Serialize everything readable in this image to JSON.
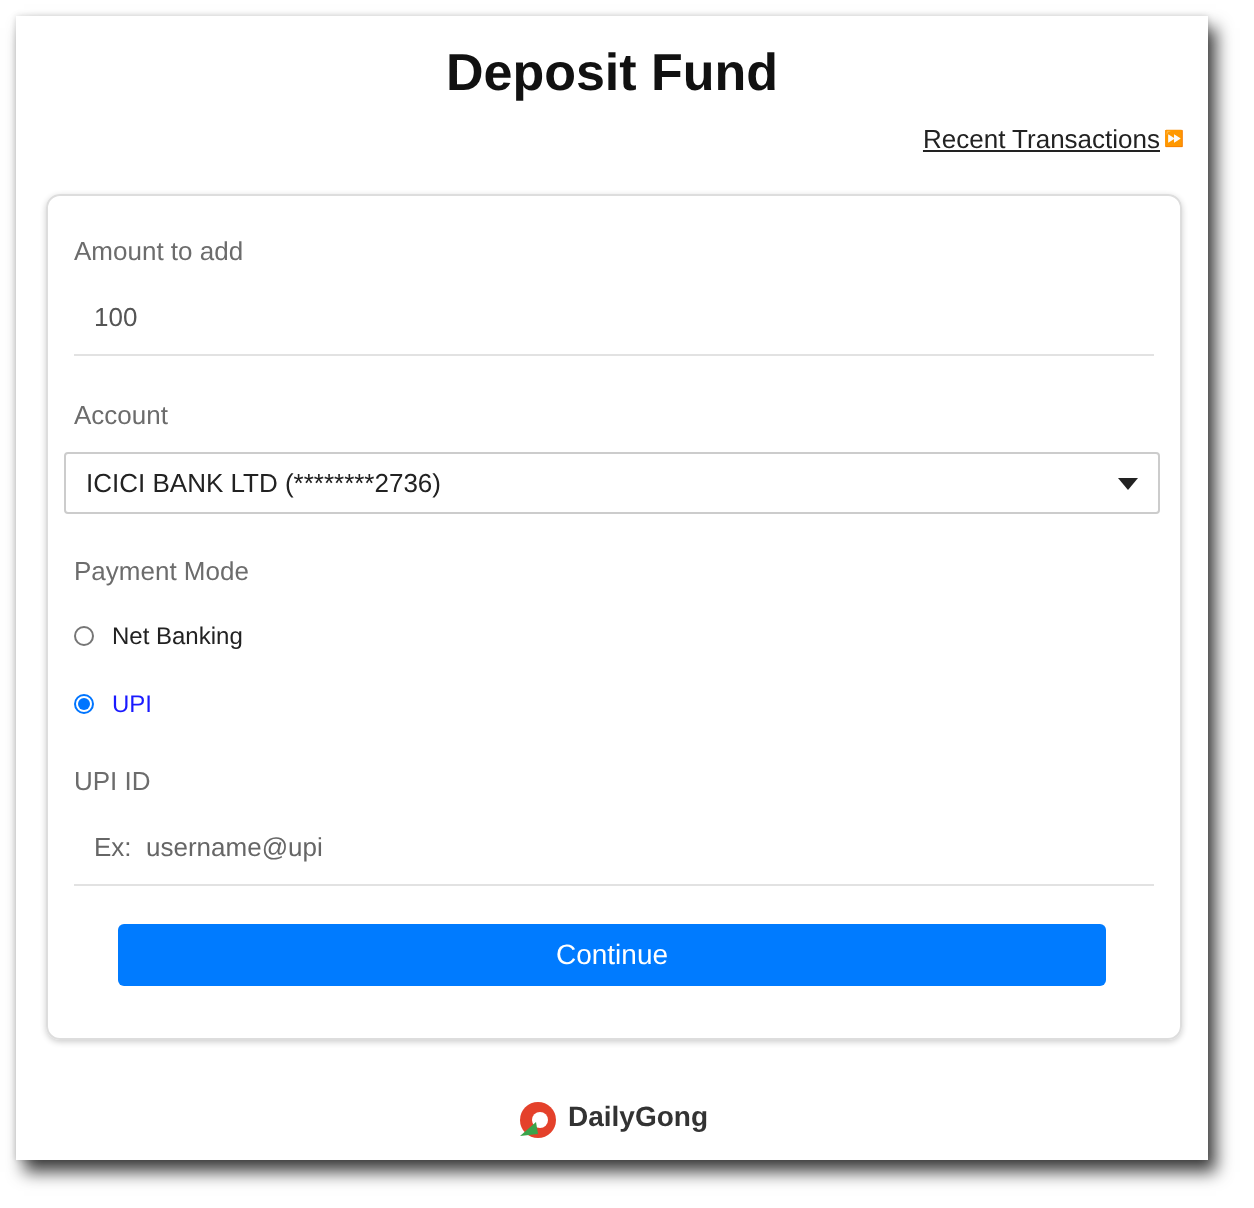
{
  "title": "Deposit Fund",
  "recent_link": {
    "label": "Recent Transactions",
    "icon": "⏩"
  },
  "form": {
    "amount": {
      "label": "Amount to add",
      "value": "100"
    },
    "account": {
      "label": "Account",
      "value": "ICICI BANK LTD (********2736)"
    },
    "payment_mode": {
      "label": "Payment Mode",
      "options": [
        {
          "label": "Net Banking",
          "selected": false
        },
        {
          "label": "UPI",
          "selected": true
        }
      ]
    },
    "upi_id": {
      "label": "UPI ID",
      "placeholder": "Ex:  username@upi"
    },
    "submit": "Continue"
  },
  "footer": {
    "brand": "DailyGong"
  }
}
